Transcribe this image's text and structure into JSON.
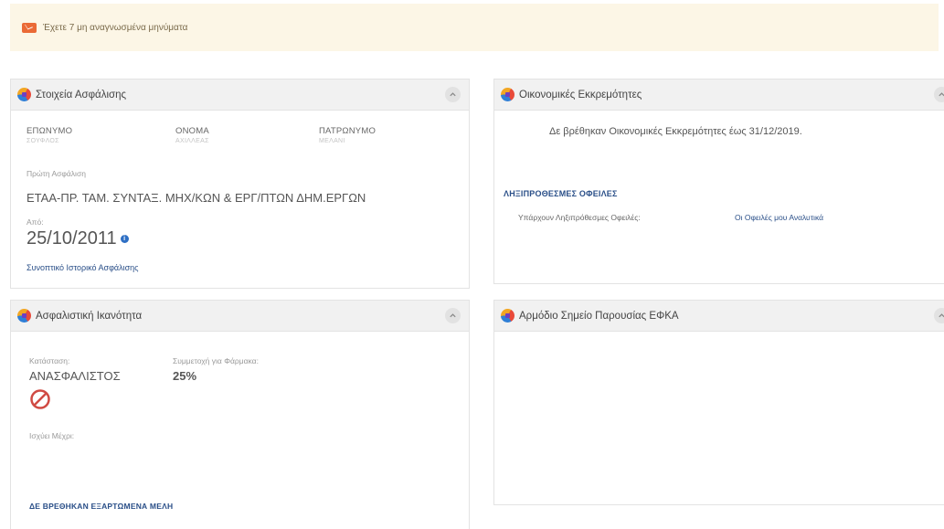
{
  "alert": {
    "text": "Έχετε 7 μη αναγνωσμένα μηνύματα",
    "icon": "envelope-icon",
    "color": "#ea6a36"
  },
  "insurance_panel": {
    "title": "Στοιχεία Ασφάλισης",
    "surname_label": "ΕΠΩΝΥΜΟ",
    "surname_value": "ΣΟΥΦΛΟΣ",
    "name_label": "ΟΝΟΜΑ",
    "name_value": "ΑΧΙΛΛΕΑΣ",
    "father_label": "ΠΑΤΡΩΝΥΜΟ",
    "father_value": "ΜΕΛΑΝΙ",
    "first_insurance_label": "Πρώτη Ασφάλιση",
    "first_insurance_value": "ΕΤΑΑ-ΠΡ. ΤΑΜ. ΣΥΝΤΑΞ. ΜΗΧ/ΚΩΝ & ΕΡΓ/ΠΤΩΝ ΔΗΜ.ΕΡΓΩΝ",
    "from_label": "Από:",
    "from_date": "25/10/2011",
    "info_glyph": "i",
    "history_link": "Συνοπτικό Ιστορικό Ασφάλισης"
  },
  "financial_panel": {
    "title": "Οικονομικές Εκκρεμότητες",
    "message": "Δε βρέθηκαν Οικονομικές Εκκρεμότητες έως 31/12/2019.",
    "overdue_heading": "ΛΗΞΙΠΡΟΘΕΣΜΕΣ ΟΦΕΙΛΕΣ",
    "overdue_label": "Υπάρχουν Ληξιπρόθεσμες Οφειλές:",
    "overdue_link": "Οι Οφειλές μου Αναλυτικά"
  },
  "capacity_panel": {
    "title": "Ασφαλιστική Ικανότητα",
    "status_label": "Κατάσταση:",
    "status_value": "ΑΝΑΣΦΑΛΙΣΤΟΣ",
    "status_icon": "prohibited-icon",
    "contribution_label": "Συμμετοχή για Φάρμακα:",
    "contribution_value": "25%",
    "valid_label": "Ισχύει Μέχρι:",
    "dependents_text": "ΔΕ ΒΡΕΘΗΚΑΝ ΕΞΑΡΤΩΜΕΝΑ ΜΕΛΗ"
  },
  "efka_panel": {
    "title": "Αρμόδιο Σημείο Παρουσίας ΕΦΚΑ"
  },
  "colors": {
    "alert_bg": "#fcf6e6",
    "link_blue": "#2a4f88",
    "prohibited_red": "#d04a43",
    "panel_header_bg": "#f1f1f1"
  }
}
